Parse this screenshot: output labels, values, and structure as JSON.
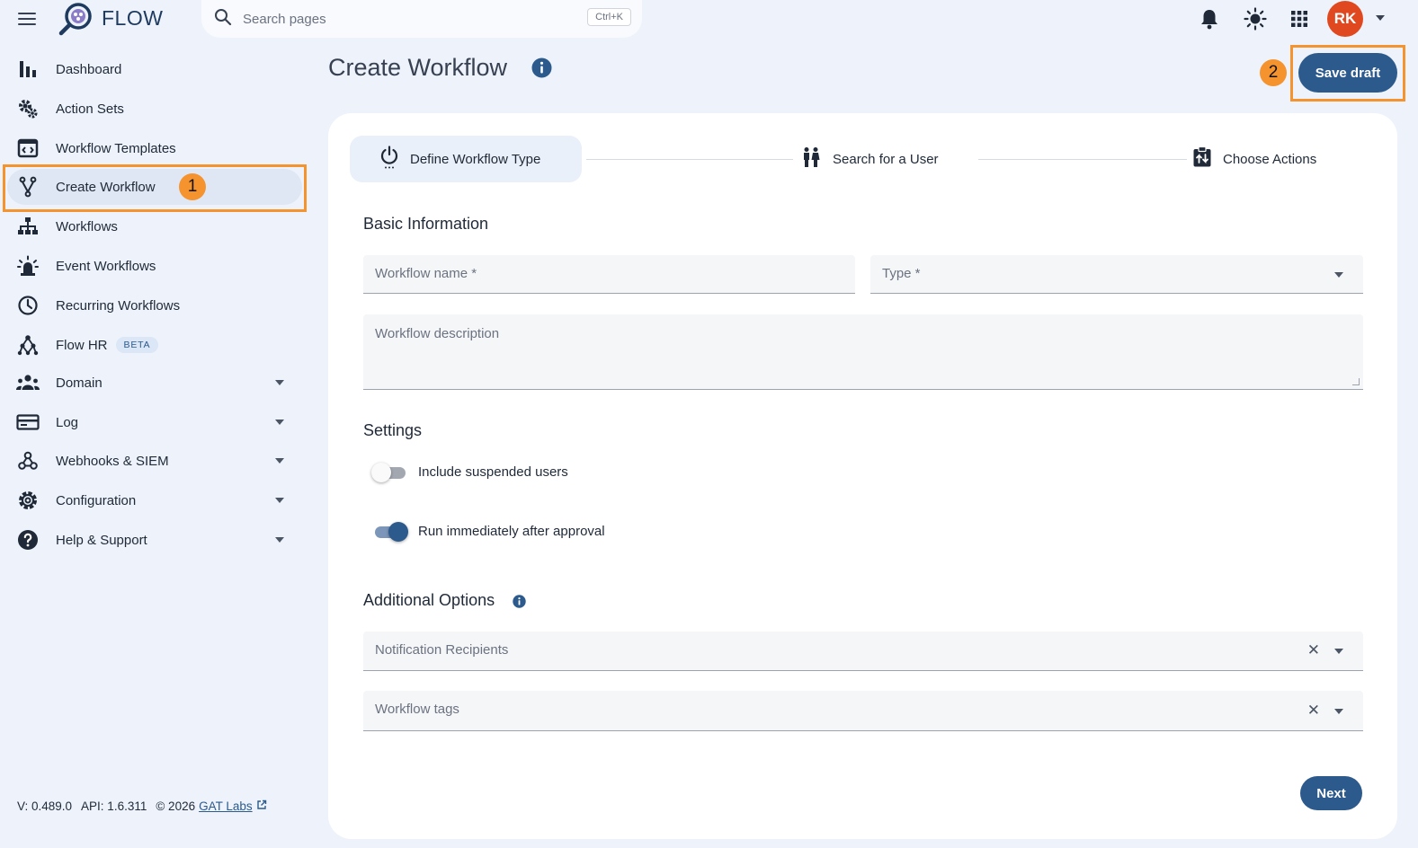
{
  "app": {
    "brand": "FLOW",
    "logo": "flow-logo-icon"
  },
  "search": {
    "placeholder": "Search pages",
    "shortcut": "Ctrl+K"
  },
  "user": {
    "initials": "RK",
    "avatar_color": "#e0491f"
  },
  "sidebar": {
    "items": [
      {
        "label": "Dashboard",
        "icon": "bar-chart-icon"
      },
      {
        "label": "Action Sets",
        "icon": "gears-icon"
      },
      {
        "label": "Workflow Templates",
        "icon": "template-icon"
      },
      {
        "label": "Create Workflow",
        "icon": "fork-icon",
        "active": true
      },
      {
        "label": "Workflows",
        "icon": "sitemap-icon"
      },
      {
        "label": "Event Workflows",
        "icon": "alarm-icon"
      },
      {
        "label": "Recurring Workflows",
        "icon": "clock-icon"
      },
      {
        "label": "Flow HR",
        "icon": "network-icon",
        "badge": "BETA"
      },
      {
        "label": "Domain",
        "icon": "users-icon",
        "expandable": true
      },
      {
        "label": "Log",
        "icon": "log-card-icon",
        "expandable": true
      },
      {
        "label": "Webhooks & SIEM",
        "icon": "webhook-icon",
        "expandable": true
      },
      {
        "label": "Configuration",
        "icon": "gear-icon",
        "expandable": true
      },
      {
        "label": "Help & Support",
        "icon": "help-icon",
        "expandable": true
      }
    ],
    "footer": {
      "version": "V: 0.489.0",
      "api": "API: 1.6.311",
      "copyright": "© 2026",
      "link": "GAT Labs"
    }
  },
  "annotations": {
    "badge1": "1",
    "badge2": "2",
    "highlight_color": "#f5932e"
  },
  "page": {
    "title": "Create Workflow",
    "save_label": "Save draft",
    "next_label": "Next"
  },
  "stepper": {
    "steps": [
      {
        "label": "Define Workflow Type",
        "icon": "power-icon",
        "active": true
      },
      {
        "label": "Search for a User",
        "icon": "people-icon"
      },
      {
        "label": "Choose Actions",
        "icon": "actions-icon"
      }
    ]
  },
  "form": {
    "basic_title": "Basic Information",
    "name_placeholder": "Workflow name *",
    "type_placeholder": "Type *",
    "description_placeholder": "Workflow description",
    "settings_title": "Settings",
    "toggle_suspended": {
      "label": "Include suspended users",
      "on": false
    },
    "toggle_run": {
      "label": "Run immediately after approval",
      "on": true
    },
    "additional_title": "Additional Options",
    "recipients_placeholder": "Notification Recipients",
    "tags_placeholder": "Workflow tags"
  },
  "colors": {
    "primary": "#2c5a8c",
    "background": "#eef3fb"
  }
}
